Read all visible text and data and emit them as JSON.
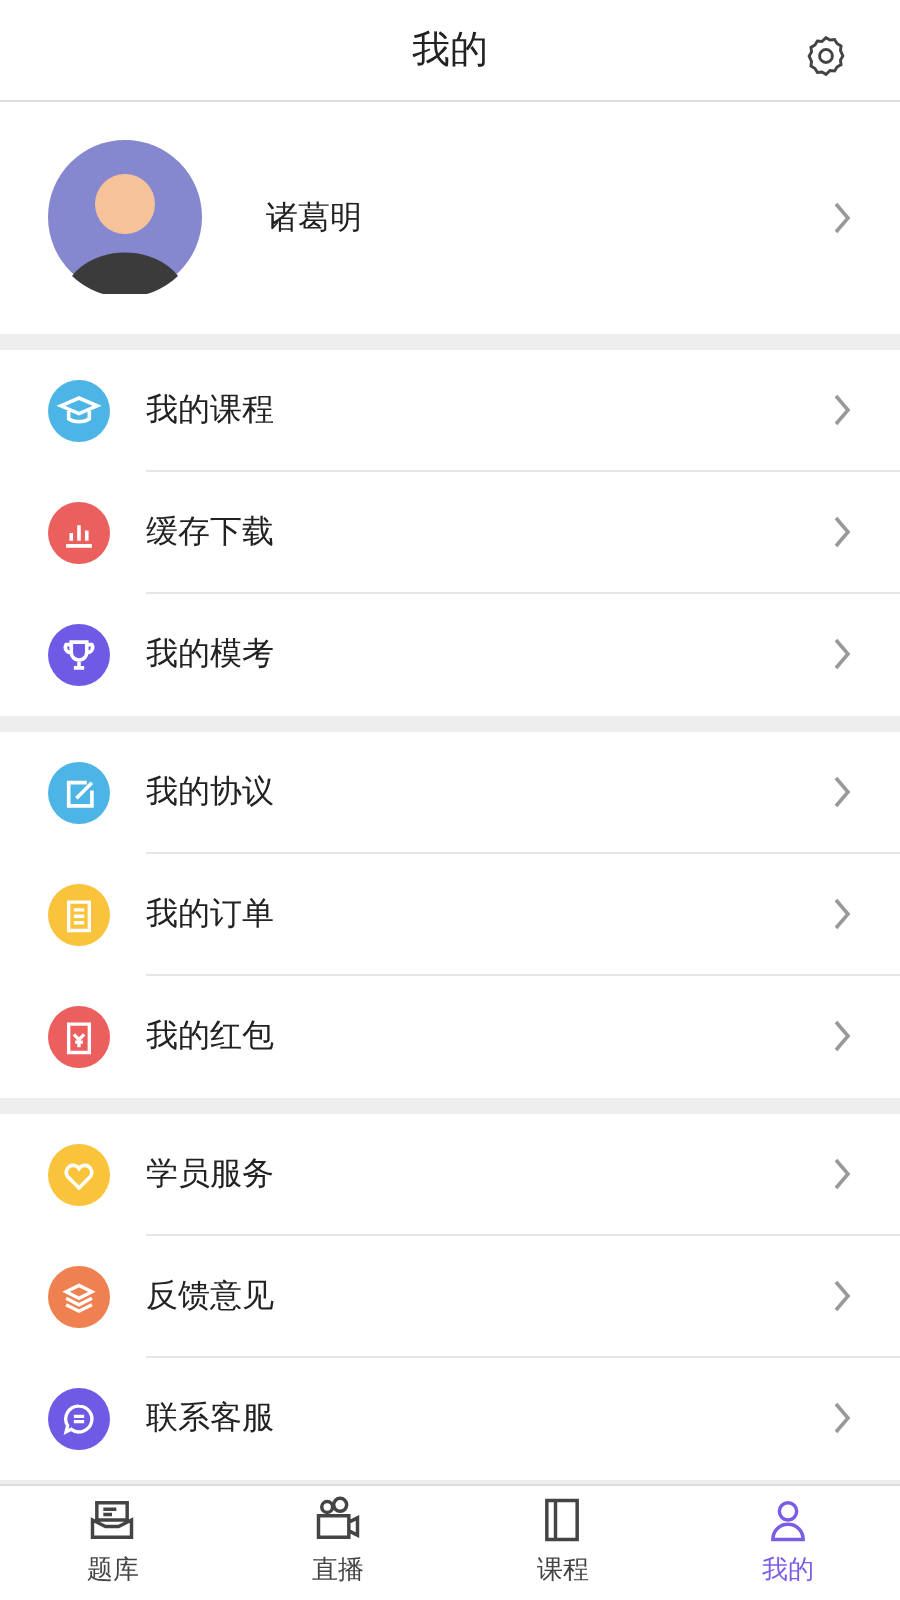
{
  "header": {
    "title": "我的"
  },
  "profile": {
    "name": "诸葛明"
  },
  "groups": [
    {
      "items": [
        {
          "label": "我的课程",
          "color": "#4cb5e6"
        },
        {
          "label": "缓存下载",
          "color": "#ec5f5f"
        },
        {
          "label": "我的模考",
          "color": "#6f5ae6"
        }
      ]
    },
    {
      "items": [
        {
          "label": "我的协议",
          "color": "#4cb5e6"
        },
        {
          "label": "我的订单",
          "color": "#f9c33c"
        },
        {
          "label": "我的红包",
          "color": "#ec5f5f"
        }
      ]
    },
    {
      "items": [
        {
          "label": "学员服务",
          "color": "#f9c33c"
        },
        {
          "label": "反馈意见",
          "color": "#ef8050"
        },
        {
          "label": "联系客服",
          "color": "#6f5ae6"
        }
      ]
    }
  ],
  "tabs": [
    {
      "label": "题库",
      "selected": false
    },
    {
      "label": "直播",
      "selected": false
    },
    {
      "label": "课程",
      "selected": false
    },
    {
      "label": "我的",
      "selected": true
    }
  ]
}
